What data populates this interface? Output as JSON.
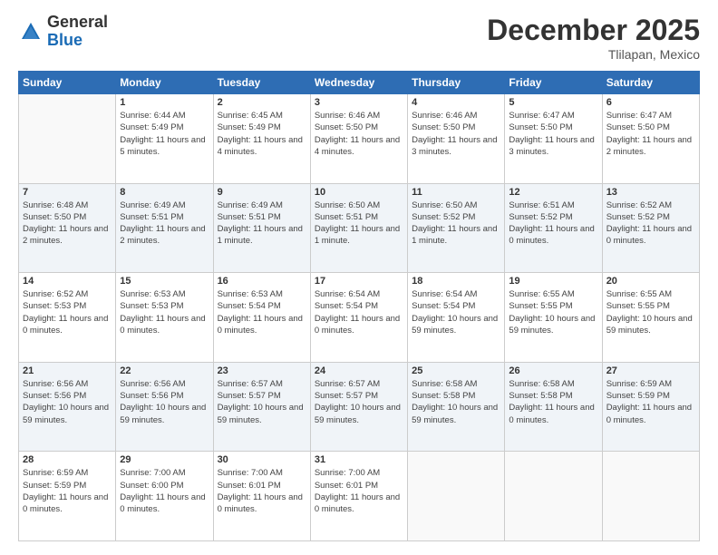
{
  "header": {
    "logo_general": "General",
    "logo_blue": "Blue",
    "month_title": "December 2025",
    "location": "Tlilapan, Mexico"
  },
  "days_of_week": [
    "Sunday",
    "Monday",
    "Tuesday",
    "Wednesday",
    "Thursday",
    "Friday",
    "Saturday"
  ],
  "weeks": [
    [
      {
        "day": "",
        "sunrise": "",
        "sunset": "",
        "daylight": ""
      },
      {
        "day": "1",
        "sunrise": "Sunrise: 6:44 AM",
        "sunset": "Sunset: 5:49 PM",
        "daylight": "Daylight: 11 hours and 5 minutes."
      },
      {
        "day": "2",
        "sunrise": "Sunrise: 6:45 AM",
        "sunset": "Sunset: 5:49 PM",
        "daylight": "Daylight: 11 hours and 4 minutes."
      },
      {
        "day": "3",
        "sunrise": "Sunrise: 6:46 AM",
        "sunset": "Sunset: 5:50 PM",
        "daylight": "Daylight: 11 hours and 4 minutes."
      },
      {
        "day": "4",
        "sunrise": "Sunrise: 6:46 AM",
        "sunset": "Sunset: 5:50 PM",
        "daylight": "Daylight: 11 hours and 3 minutes."
      },
      {
        "day": "5",
        "sunrise": "Sunrise: 6:47 AM",
        "sunset": "Sunset: 5:50 PM",
        "daylight": "Daylight: 11 hours and 3 minutes."
      },
      {
        "day": "6",
        "sunrise": "Sunrise: 6:47 AM",
        "sunset": "Sunset: 5:50 PM",
        "daylight": "Daylight: 11 hours and 2 minutes."
      }
    ],
    [
      {
        "day": "7",
        "sunrise": "Sunrise: 6:48 AM",
        "sunset": "Sunset: 5:50 PM",
        "daylight": "Daylight: 11 hours and 2 minutes."
      },
      {
        "day": "8",
        "sunrise": "Sunrise: 6:49 AM",
        "sunset": "Sunset: 5:51 PM",
        "daylight": "Daylight: 11 hours and 2 minutes."
      },
      {
        "day": "9",
        "sunrise": "Sunrise: 6:49 AM",
        "sunset": "Sunset: 5:51 PM",
        "daylight": "Daylight: 11 hours and 1 minute."
      },
      {
        "day": "10",
        "sunrise": "Sunrise: 6:50 AM",
        "sunset": "Sunset: 5:51 PM",
        "daylight": "Daylight: 11 hours and 1 minute."
      },
      {
        "day": "11",
        "sunrise": "Sunrise: 6:50 AM",
        "sunset": "Sunset: 5:52 PM",
        "daylight": "Daylight: 11 hours and 1 minute."
      },
      {
        "day": "12",
        "sunrise": "Sunrise: 6:51 AM",
        "sunset": "Sunset: 5:52 PM",
        "daylight": "Daylight: 11 hours and 0 minutes."
      },
      {
        "day": "13",
        "sunrise": "Sunrise: 6:52 AM",
        "sunset": "Sunset: 5:52 PM",
        "daylight": "Daylight: 11 hours and 0 minutes."
      }
    ],
    [
      {
        "day": "14",
        "sunrise": "Sunrise: 6:52 AM",
        "sunset": "Sunset: 5:53 PM",
        "daylight": "Daylight: 11 hours and 0 minutes."
      },
      {
        "day": "15",
        "sunrise": "Sunrise: 6:53 AM",
        "sunset": "Sunset: 5:53 PM",
        "daylight": "Daylight: 11 hours and 0 minutes."
      },
      {
        "day": "16",
        "sunrise": "Sunrise: 6:53 AM",
        "sunset": "Sunset: 5:54 PM",
        "daylight": "Daylight: 11 hours and 0 minutes."
      },
      {
        "day": "17",
        "sunrise": "Sunrise: 6:54 AM",
        "sunset": "Sunset: 5:54 PM",
        "daylight": "Daylight: 11 hours and 0 minutes."
      },
      {
        "day": "18",
        "sunrise": "Sunrise: 6:54 AM",
        "sunset": "Sunset: 5:54 PM",
        "daylight": "Daylight: 10 hours and 59 minutes."
      },
      {
        "day": "19",
        "sunrise": "Sunrise: 6:55 AM",
        "sunset": "Sunset: 5:55 PM",
        "daylight": "Daylight: 10 hours and 59 minutes."
      },
      {
        "day": "20",
        "sunrise": "Sunrise: 6:55 AM",
        "sunset": "Sunset: 5:55 PM",
        "daylight": "Daylight: 10 hours and 59 minutes."
      }
    ],
    [
      {
        "day": "21",
        "sunrise": "Sunrise: 6:56 AM",
        "sunset": "Sunset: 5:56 PM",
        "daylight": "Daylight: 10 hours and 59 minutes."
      },
      {
        "day": "22",
        "sunrise": "Sunrise: 6:56 AM",
        "sunset": "Sunset: 5:56 PM",
        "daylight": "Daylight: 10 hours and 59 minutes."
      },
      {
        "day": "23",
        "sunrise": "Sunrise: 6:57 AM",
        "sunset": "Sunset: 5:57 PM",
        "daylight": "Daylight: 10 hours and 59 minutes."
      },
      {
        "day": "24",
        "sunrise": "Sunrise: 6:57 AM",
        "sunset": "Sunset: 5:57 PM",
        "daylight": "Daylight: 10 hours and 59 minutes."
      },
      {
        "day": "25",
        "sunrise": "Sunrise: 6:58 AM",
        "sunset": "Sunset: 5:58 PM",
        "daylight": "Daylight: 10 hours and 59 minutes."
      },
      {
        "day": "26",
        "sunrise": "Sunrise: 6:58 AM",
        "sunset": "Sunset: 5:58 PM",
        "daylight": "Daylight: 11 hours and 0 minutes."
      },
      {
        "day": "27",
        "sunrise": "Sunrise: 6:59 AM",
        "sunset": "Sunset: 5:59 PM",
        "daylight": "Daylight: 11 hours and 0 minutes."
      }
    ],
    [
      {
        "day": "28",
        "sunrise": "Sunrise: 6:59 AM",
        "sunset": "Sunset: 5:59 PM",
        "daylight": "Daylight: 11 hours and 0 minutes."
      },
      {
        "day": "29",
        "sunrise": "Sunrise: 7:00 AM",
        "sunset": "Sunset: 6:00 PM",
        "daylight": "Daylight: 11 hours and 0 minutes."
      },
      {
        "day": "30",
        "sunrise": "Sunrise: 7:00 AM",
        "sunset": "Sunset: 6:01 PM",
        "daylight": "Daylight: 11 hours and 0 minutes."
      },
      {
        "day": "31",
        "sunrise": "Sunrise: 7:00 AM",
        "sunset": "Sunset: 6:01 PM",
        "daylight": "Daylight: 11 hours and 0 minutes."
      },
      {
        "day": "",
        "sunrise": "",
        "sunset": "",
        "daylight": ""
      },
      {
        "day": "",
        "sunrise": "",
        "sunset": "",
        "daylight": ""
      },
      {
        "day": "",
        "sunrise": "",
        "sunset": "",
        "daylight": ""
      }
    ]
  ]
}
